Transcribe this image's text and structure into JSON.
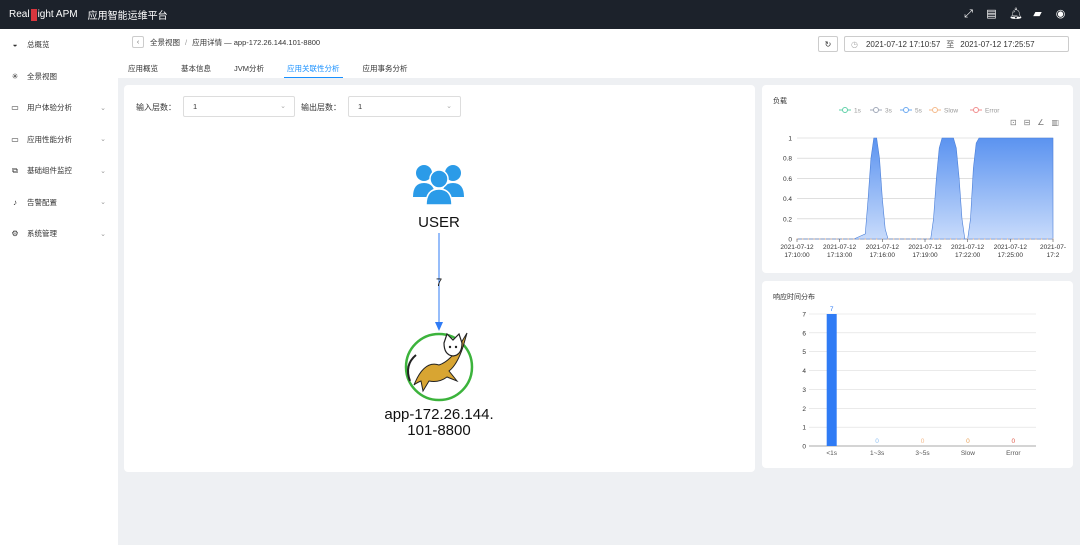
{
  "topbar": {
    "brand_left": "Real",
    "brand_right": "ight APM",
    "platform": "应用智能运维平台",
    "icons": [
      "expand-icon",
      "id-card-icon",
      "bell-icon",
      "book-icon",
      "user-circle-icon"
    ]
  },
  "sidebar": {
    "items": [
      {
        "label": "总概览",
        "icon": "dashboard-icon",
        "expandable": false
      },
      {
        "label": "全景视图",
        "icon": "panorama-icon",
        "expandable": false
      },
      {
        "label": "用户体验分析",
        "icon": "monitor-icon",
        "expandable": true
      },
      {
        "label": "应用性能分析",
        "icon": "screen-icon",
        "expandable": true
      },
      {
        "label": "基础组件监控",
        "icon": "components-icon",
        "expandable": true
      },
      {
        "label": "告警配置",
        "icon": "bell-icon",
        "expandable": true
      },
      {
        "label": "系统管理",
        "icon": "gear-icon",
        "expandable": true
      }
    ]
  },
  "header": {
    "breadcrumb_root": "全景视图",
    "breadcrumb_sep": "/",
    "breadcrumb_current": "应用详情 — app-172.26.144.101-8800",
    "tabs": [
      {
        "label": "应用概览"
      },
      {
        "label": "基本信息"
      },
      {
        "label": "JVM分析"
      },
      {
        "label": "应用关联性分析"
      },
      {
        "label": "应用事务分析"
      }
    ],
    "active_tab": 3,
    "time_start": "2021-07-12 17:10:57",
    "time_sep": "至",
    "time_end": "2021-07-12 17:25:57"
  },
  "topology": {
    "input_label": "输入层数：",
    "input_value": "1",
    "output_label": "输出层数：",
    "output_value": "1",
    "source_node": "USER",
    "edge_count": "7",
    "target_node_line1": "app-172.26.144.",
    "target_node_line2": "101-8800"
  },
  "load_chart": {
    "title": "负载",
    "toolbox": [
      "zoom-icon",
      "zoom-reset-icon",
      "line-icon",
      "bar-icon"
    ]
  },
  "response_chart": {
    "title": "响应时间分布"
  },
  "colors": {
    "accent": "#1890ff",
    "topbar": "#1c222b",
    "area": "#7aa9f5",
    "bar": "#2f7bf5",
    "series_1s": "#5fd0a8",
    "series_3s": "#a0a8b8",
    "series_5s": "#6aa8f0",
    "series_slow": "#f4b98a",
    "series_error": "#f08c8c"
  },
  "chart_data": [
    {
      "type": "area",
      "title": "负载",
      "series": [
        {
          "name": "1s",
          "values": [
            0,
            0,
            0,
            0,
            0,
            0,
            0,
            0,
            0,
            0,
            0,
            0,
            0,
            0,
            0,
            0,
            0,
            0,
            0,
            0,
            0,
            0,
            0,
            0,
            0,
            0,
            0,
            0,
            0,
            0,
            0,
            0,
            0,
            0,
            0,
            0,
            0,
            0,
            0,
            0,
            0,
            0,
            0,
            0,
            0,
            0,
            0,
            0,
            0,
            0,
            0,
            0,
            0,
            0,
            0,
            0,
            0,
            0,
            0,
            0,
            0,
            0,
            0,
            0,
            0,
            0,
            0,
            0,
            0,
            0,
            0,
            0,
            0,
            0,
            0,
            0,
            0,
            0,
            0,
            0,
            0,
            0,
            0,
            0,
            0,
            0,
            0,
            0,
            0,
            0,
            0
          ]
        },
        {
          "name": "3s",
          "values": []
        },
        {
          "name": "5s",
          "values": []
        },
        {
          "name": "Slow",
          "values": []
        },
        {
          "name": "Error",
          "values": []
        }
      ],
      "load_points": [
        [
          0,
          0
        ],
        [
          15,
          0
        ],
        [
          20,
          0
        ],
        [
          24,
          0.05
        ],
        [
          25,
          0.4
        ],
        [
          26,
          0.8
        ],
        [
          27,
          1
        ],
        [
          28,
          1
        ],
        [
          29,
          0.8
        ],
        [
          30,
          0.4
        ],
        [
          31,
          0.1
        ],
        [
          32,
          0
        ],
        [
          47,
          0
        ],
        [
          48,
          0.2
        ],
        [
          49,
          0.6
        ],
        [
          50,
          0.9
        ],
        [
          51,
          1
        ],
        [
          55,
          1
        ],
        [
          56,
          0.9
        ],
        [
          57,
          0.6
        ],
        [
          58,
          0.2
        ],
        [
          59,
          0
        ],
        [
          60,
          0
        ],
        [
          61,
          0.2
        ],
        [
          62,
          0.7
        ],
        [
          63,
          0.95
        ],
        [
          64,
          1
        ],
        [
          90,
          1
        ]
      ],
      "x_range": [
        0,
        90
      ],
      "x_ticks": [
        {
          "x": 0,
          "l1": "2021-07-12",
          "l2": "17:10:00"
        },
        {
          "x": 15,
          "l1": "2021-07-12",
          "l2": "17:13:00"
        },
        {
          "x": 30,
          "l1": "2021-07-12",
          "l2": "17:16:00"
        },
        {
          "x": 45,
          "l1": "2021-07-12",
          "l2": "17:19:00"
        },
        {
          "x": 60,
          "l1": "2021-07-12",
          "l2": "17:22:00"
        },
        {
          "x": 75,
          "l1": "2021-07-12",
          "l2": "17:25:00"
        },
        {
          "x": 90,
          "l1": "2021-07-",
          "l2": "17:2"
        }
      ],
      "y_ticks": [
        "0",
        "0.2",
        "0.4",
        "0.6",
        "0.8",
        "1"
      ],
      "ylim": [
        0,
        1
      ],
      "legend": [
        "1s",
        "3s",
        "5s",
        "Slow",
        "Error"
      ],
      "legend_position": "top-center",
      "grid": true
    },
    {
      "type": "bar",
      "title": "响应时间分布",
      "categories": [
        "<1s",
        "1~3s",
        "3~5s",
        "Slow",
        "Error"
      ],
      "values": [
        7,
        0,
        0,
        0,
        0
      ],
      "value_labels": [
        "7",
        "0",
        "0",
        "0",
        "0"
      ],
      "y_ticks": [
        "0",
        "1",
        "2",
        "3",
        "4",
        "5",
        "6",
        "7"
      ],
      "ylim": [
        0,
        7
      ],
      "grid": true
    }
  ]
}
